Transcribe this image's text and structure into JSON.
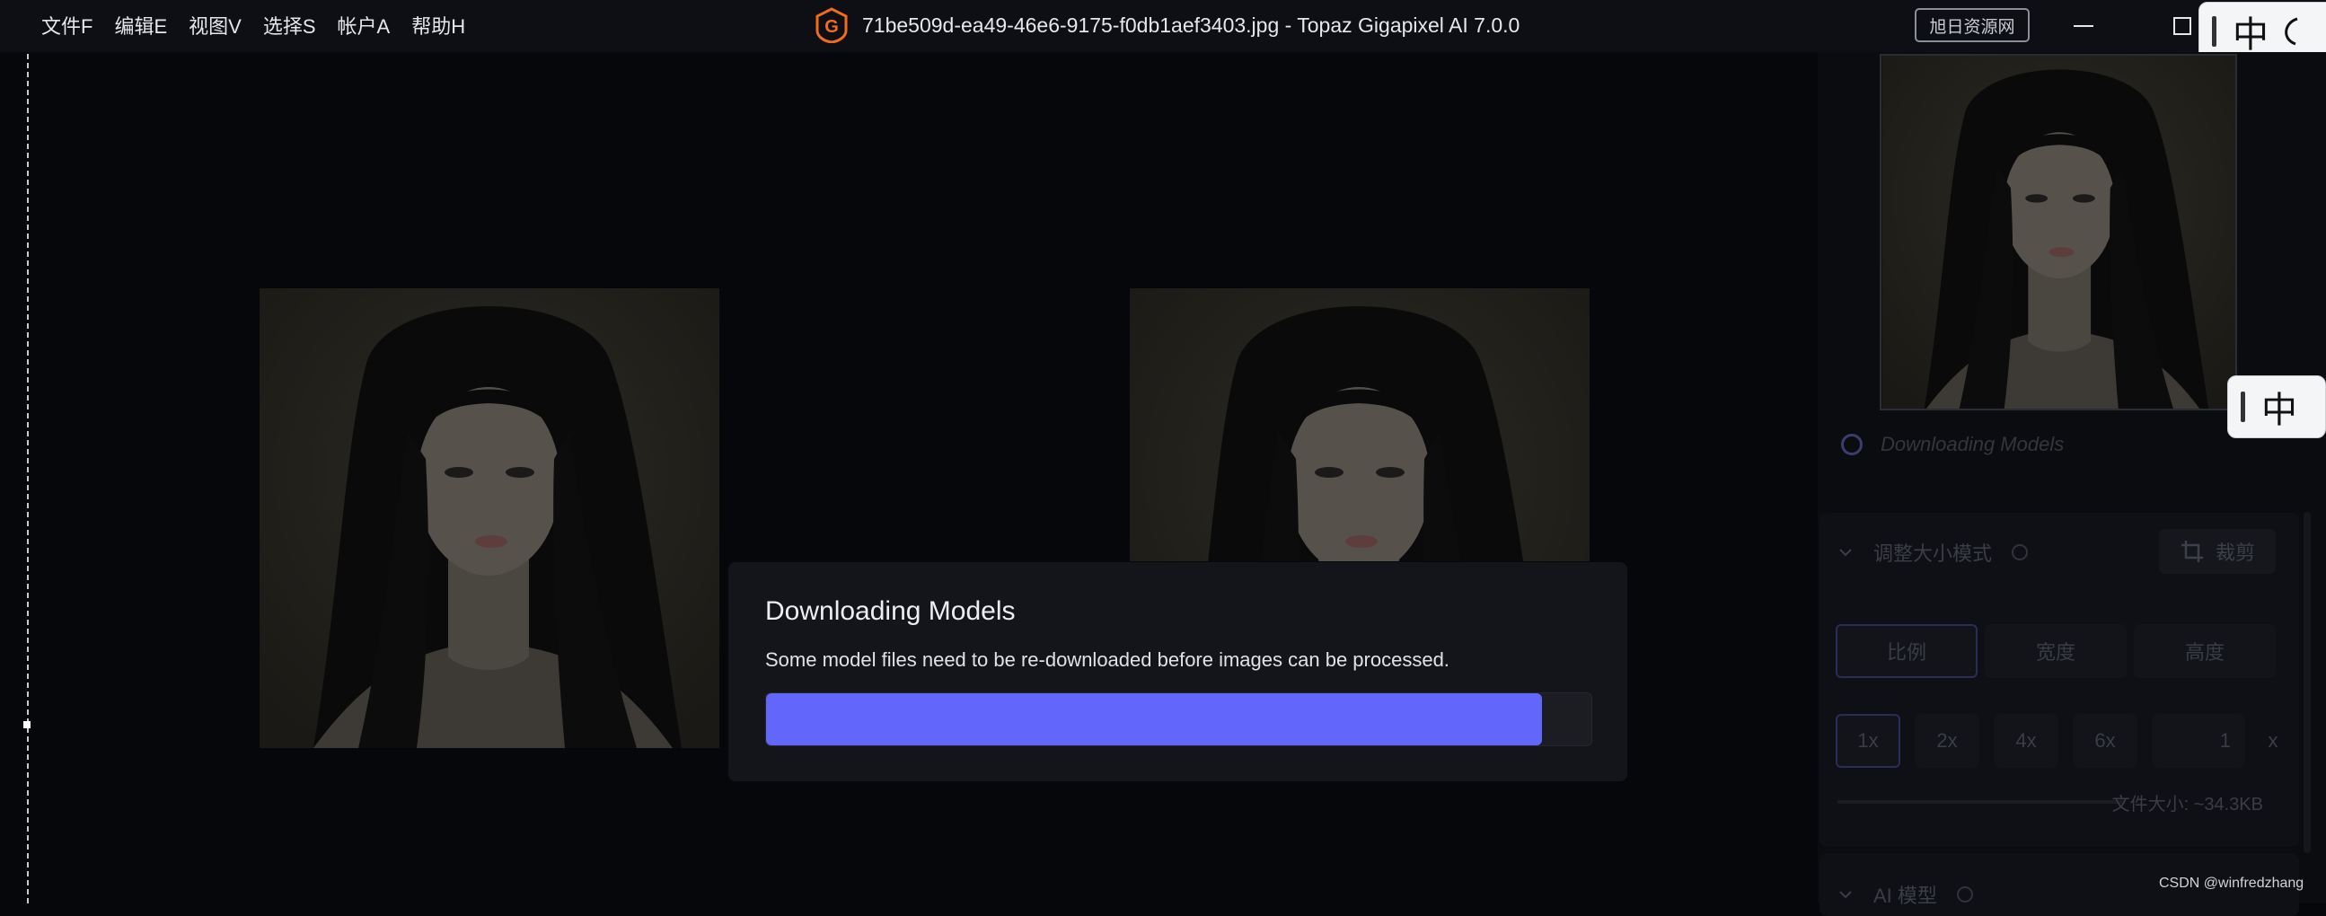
{
  "menu": {
    "file": "文件F",
    "edit": "编辑E",
    "view": "视图V",
    "select": "选择S",
    "account": "帐户A",
    "help": "帮助H"
  },
  "window": {
    "title": "71be509d-ea49-46e6-9175-f0db1aef3403.jpg - Topaz Gigapixel AI 7.0.0",
    "logo_letter": "G",
    "logo_color": "#f26b1d"
  },
  "badge": "旭日资源网",
  "ime": {
    "char": "中"
  },
  "status": {
    "text": "Downloading Models"
  },
  "resize": {
    "title": "调整大小模式",
    "crop_label": "裁剪",
    "modes": [
      "比例",
      "宽度",
      "高度"
    ],
    "scales": [
      "1x",
      "2x",
      "4x",
      "6x"
    ],
    "custom_value": "1",
    "custom_suffix": "x",
    "file_size": "文件大小: ~34.3KB"
  },
  "ai_model": {
    "title": "AI 模型"
  },
  "modal": {
    "title": "Downloading Models",
    "message": "Some model files need to be re-downloaded before images can be processed.",
    "progress": 0.94
  },
  "colors": {
    "accent": "#6366fb",
    "background": "#06070a",
    "modal_bg": "#14151b"
  },
  "watermark": "CSDN @winfredzhang"
}
